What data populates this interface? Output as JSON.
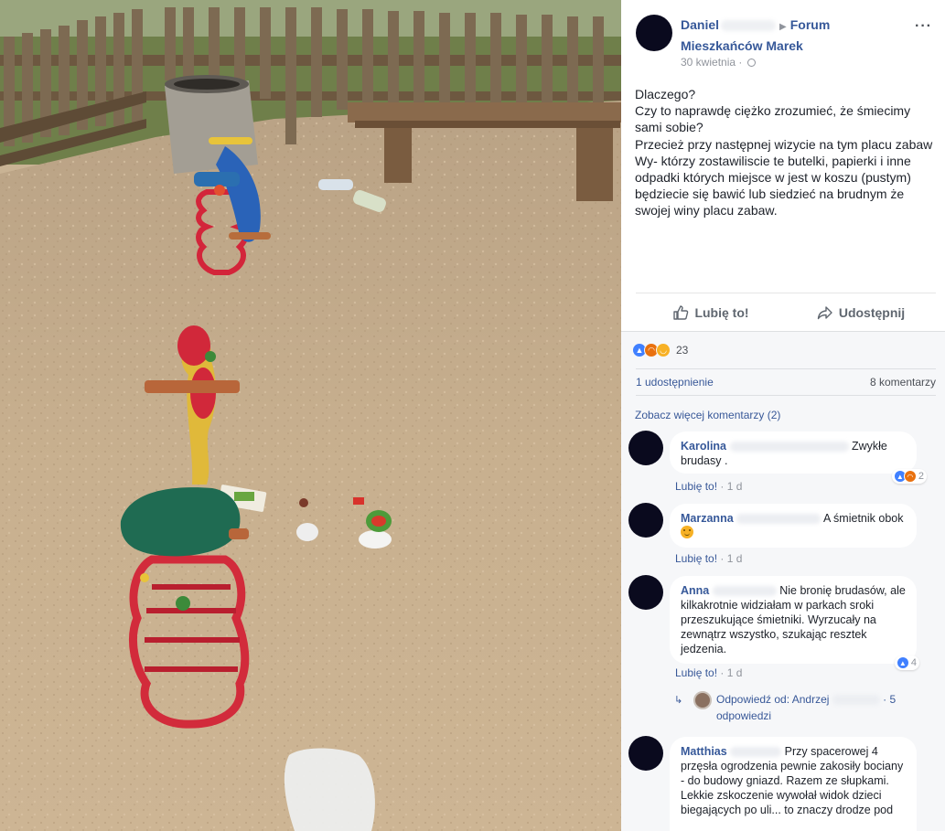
{
  "post": {
    "author": "Daniel",
    "group": "Forum Mieszkańców Marek",
    "date": "30 kwietnia",
    "date_separator": "·",
    "more_label": "···",
    "body_lines": [
      "Dlaczego?",
      "Czy to naprawdę ciężko zrozumieć, że śmiecimy sami sobie?",
      "Przecież przy następnej wizycie na tym placu zabaw Wy- którzy zostawiliscie te butelki, papierki i inne odpadki których miejsce w jest w koszu (pustym) będziecie się bawić lub siedzieć na brudnym że swojej winy placu zabaw."
    ]
  },
  "actions": {
    "like_label": "Lubię to!",
    "share_label": "Udostępnij"
  },
  "stats": {
    "reaction_count": "23",
    "shares": "1 udostępnienie",
    "comments": "8 komentarzy",
    "more_comments": "Zobacz więcej komentarzy (2)"
  },
  "comments": [
    {
      "name": "Karolina",
      "text": "Zwykłe brudasy .",
      "like_label": "Lubię to!",
      "separator": "·",
      "age": "1 d",
      "reactions": "2"
    },
    {
      "name": "Marzanna",
      "text": "A śmietnik obok",
      "like_label": "Lubię to!",
      "separator": "·",
      "age": "1 d"
    },
    {
      "name": "Anna",
      "text": "Nie bronię brudasów, ale kilkakrotnie widziałam w parkach sroki przeszukujące śmietniki. Wyrzucały na zewnątrz wszystko, szukając resztek jedzenia.",
      "like_label": "Lubię to!",
      "separator": "·",
      "age": "1 d",
      "reactions": "4",
      "reply_summary": "Odpowiedź od: Andrzej",
      "reply_count": "· 5 odpowiedzi"
    },
    {
      "name": "Matthias",
      "text": "Przy spacerowej 4 przęsła ogrodzenia pewnie zakosiły bociany - do budowy gniazd. Razem ze słupkami.",
      "text2": "Lekkie zskoczenie wywołał widok dzieci biegających po uli... to znaczy drodze pod"
    }
  ],
  "colors": {
    "link_blue": "#365899",
    "like_blue": "#4080ff",
    "angry_orange": "#e9710f",
    "sad_yellow": "#f7b125",
    "feedback_bg": "#f6f7f9"
  },
  "icons": {
    "like": "thumbs-up-icon",
    "share": "share-arrow-icon",
    "privacy": "globe-icon",
    "reply": "reply-arrow-icon"
  }
}
